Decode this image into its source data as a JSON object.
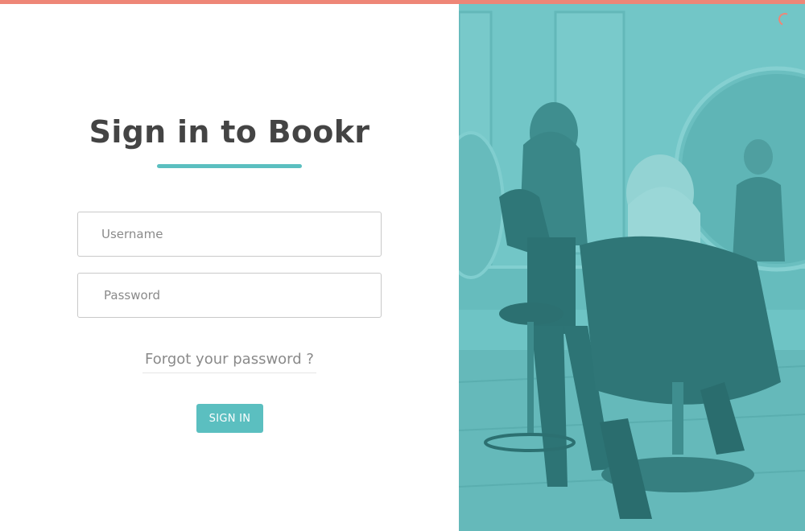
{
  "colors": {
    "accent": "#5bbfc0",
    "top_bar": "#ee8677",
    "title_text": "#444444"
  },
  "login": {
    "title": "Sign in to Bookr",
    "username_placeholder": "Username",
    "password_placeholder": "Password",
    "forgot_label": "Forgot your password ?",
    "signin_label": "SIGN IN"
  },
  "hero": {
    "loading_icon": "loading-spinner-icon"
  }
}
